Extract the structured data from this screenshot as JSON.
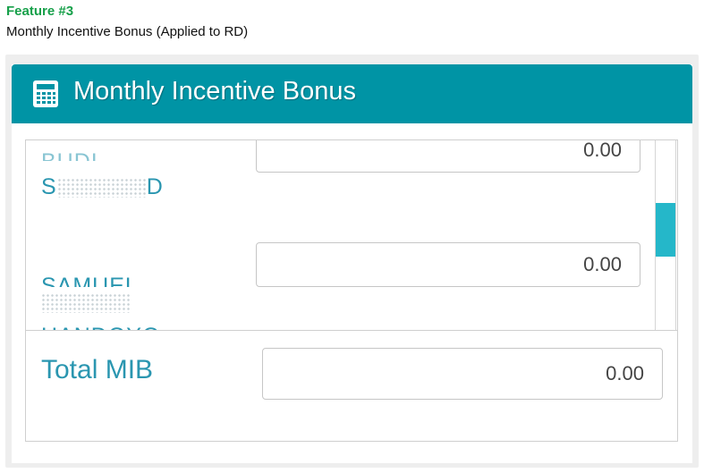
{
  "feature": {
    "title": "Feature #3",
    "subtitle": "Monthly Incentive Bonus (Applied to RD)"
  },
  "panel": {
    "title": "Monthly Incentive Bonus",
    "icon": "calculator-icon",
    "header_color": "#0094a5"
  },
  "employees": [
    {
      "name_line1": "BUDI",
      "name_line2": "S",
      "name_line2_end": "D",
      "value": "0.00"
    },
    {
      "name_line1": "SAMUEL",
      "name_line3": "HANDOYO",
      "value": "0.00"
    }
  ],
  "total": {
    "label": "Total MIB",
    "value": "0.00"
  },
  "colors": {
    "label": "#2a96b0",
    "scroll_thumb": "#25b7c9",
    "feature_title": "#17a04a"
  }
}
